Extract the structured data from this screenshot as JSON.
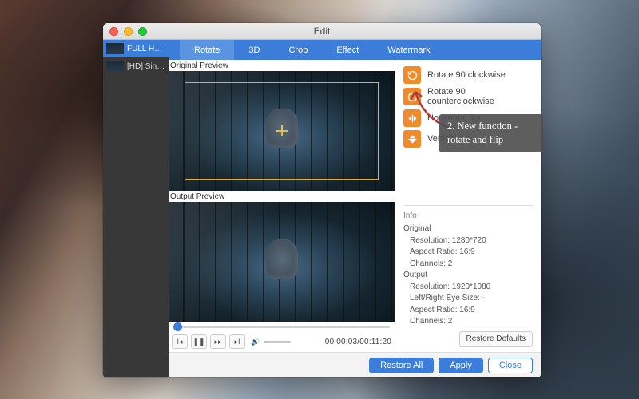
{
  "window": {
    "title": "Edit"
  },
  "sidebar": {
    "items": [
      {
        "label": "FULL HD ..."
      },
      {
        "label": "[HD] Sing-..."
      }
    ]
  },
  "tabs": {
    "items": [
      {
        "label": "Rotate"
      },
      {
        "label": "3D"
      },
      {
        "label": "Crop"
      },
      {
        "label": "Effect"
      },
      {
        "label": "Watermark"
      }
    ]
  },
  "preview": {
    "original_label": "Original Preview",
    "output_label": "Output Preview",
    "time": "00:00:03/00:11:20"
  },
  "rotate": {
    "opts": [
      {
        "label": "Rotate 90 clockwise"
      },
      {
        "label": "Rotate 90 counterclockwise"
      },
      {
        "label": "Horizontal flip"
      },
      {
        "label": "Vertical flip"
      }
    ]
  },
  "info": {
    "heading": "Info",
    "original_label": "Original",
    "original": {
      "resolution": "Resolution: 1280*720",
      "aspect": "Aspect Ratio: 16:9",
      "channels": "Channels: 2"
    },
    "output_label": "Output",
    "output": {
      "resolution": "Resolution: 1920*1080",
      "eyesize": "Left/Right Eye Size: -",
      "aspect": "Aspect Ratio: 16:9",
      "channels": "Channels: 2"
    },
    "restore_defaults": "Restore Defaults"
  },
  "footer": {
    "restore_all": "Restore All",
    "apply": "Apply",
    "close": "Close"
  },
  "callout": {
    "text": "2. New function - rotate and flip"
  }
}
